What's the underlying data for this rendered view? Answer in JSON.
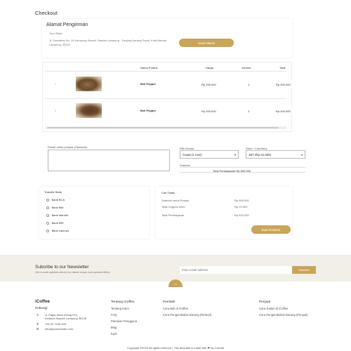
{
  "page_title": "Checkout",
  "address": {
    "title": "Alamat Pengiriman",
    "name": "Touri Rizki",
    "line": "Jl. Sumatera No. 10 Kampung Sawah, Bandar Lampung - Tanjung Karang Pusat, Kota Bandar Lampung, 35116",
    "change_button": "Ganti Alamat"
  },
  "table": {
    "headers": [
      "Nama Produk",
      "Harga",
      "Jumlah",
      "Total"
    ],
    "rows": [
      {
        "remove": "×",
        "name": "Bell Pepper",
        "price": "Rp 200.000",
        "qty": "1",
        "total": "Rp 200.000"
      },
      {
        "remove": "×",
        "name": "Bell Pepper",
        "price": "Rp 200.000",
        "qty": "1",
        "total": "Rp 200.000"
      }
    ]
  },
  "note": {
    "label": "Pesan untuk penjual (Opsional)"
  },
  "shipping": {
    "duration_label": "Pilih Durasi",
    "duration_value": "Cepat (1 Hari)",
    "courier_label": "Store / Courrierry",
    "courier_value": "J&T (Rp 22.000)",
    "subtotal_label": "Subtotal",
    "subtotal_value": "Total Pembayaran Rp 500.000"
  },
  "payment": {
    "title": "Transfer Bank",
    "options": [
      "Bank BCA",
      "Bank BNI",
      "Bank Mandiri",
      "Bank BRI",
      "Bank Lainnya"
    ]
  },
  "cart_totals": {
    "title": "Cart Totals",
    "rows": [
      {
        "label": "Subtotal untuk Produk",
        "value": "Rp 500.000"
      },
      {
        "label": "Total Ongkos Kirim",
        "value": "Rp 22.000"
      },
      {
        "label": "Total Pembayaran",
        "value": "Rp 522.000"
      }
    ],
    "pay_button": "Buat Pesanan"
  },
  "newsletter": {
    "title": "Subcribe to our Newsletter",
    "subtitle": "Get e-mail updates about our latest shops and special offers",
    "placeholder": "Enter email address",
    "button": "Subcribe"
  },
  "footer": {
    "brand": "iCoffee",
    "contact_title": "Hubungi:",
    "address": "Jl. Pagar Alam (Gang PU) Kedaton Bandar Lampung 35148",
    "phone": "+62 81 7160 626",
    "email": "info@yourdomain.com",
    "col1": {
      "title": "Tentang iCoffee",
      "links": [
        "Tentang Kami",
        "FAQ",
        "Panduan Pengguna",
        "Blog",
        "Karir"
      ]
    },
    "col2": {
      "title": "Pembeli",
      "links": [
        "Cara Beli di iCoffee",
        "Cara Pengembalian Barang (Refund)"
      ]
    },
    "col3": {
      "title": "Penjual",
      "links": [
        "Cara Jualan di iCoffee",
        "Cara Pengembalian Barang (Penjual)"
      ]
    },
    "copyright": "Copyright ©2020 All rights reserved | This template is made with ❤ by Colorlib"
  },
  "colors": {
    "accent": "#c9a55a",
    "newsletter_bg": "#f2efe8"
  }
}
